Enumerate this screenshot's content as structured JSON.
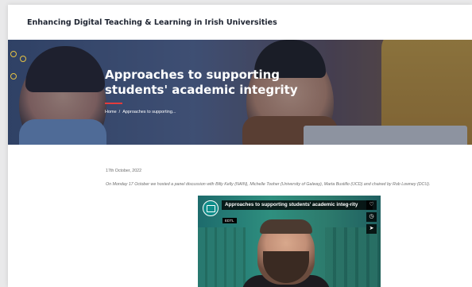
{
  "site": {
    "title": "Enhancing Digital Teaching & Learning in Irish Universities"
  },
  "hero": {
    "title": "Approaches to supporting students' academic integrity",
    "breadcrumb": {
      "home": "Home",
      "separator": "/",
      "current": "Approaches to supporting..."
    }
  },
  "post": {
    "date": "17th October, 2022",
    "intro": "On Monday 17 October we hosted a panel discussion with Billy Kelly (NAIN), Michelle Tooher (University of Galway), Marta Bustillo (UCD) and chaired by Rob Lowney (DCU)."
  },
  "video": {
    "title": "Approaches to supporting students' academic integ-rity",
    "badge": "EDTL",
    "controls": [
      {
        "name": "heart-icon",
        "glyph": "♡"
      },
      {
        "name": "clock-icon",
        "glyph": "◷"
      },
      {
        "name": "share-icon",
        "glyph": "➤"
      }
    ]
  },
  "colors": {
    "accent": "#e33c3c",
    "header_text": "#1f2532",
    "hero_ring": "#e5c244"
  }
}
